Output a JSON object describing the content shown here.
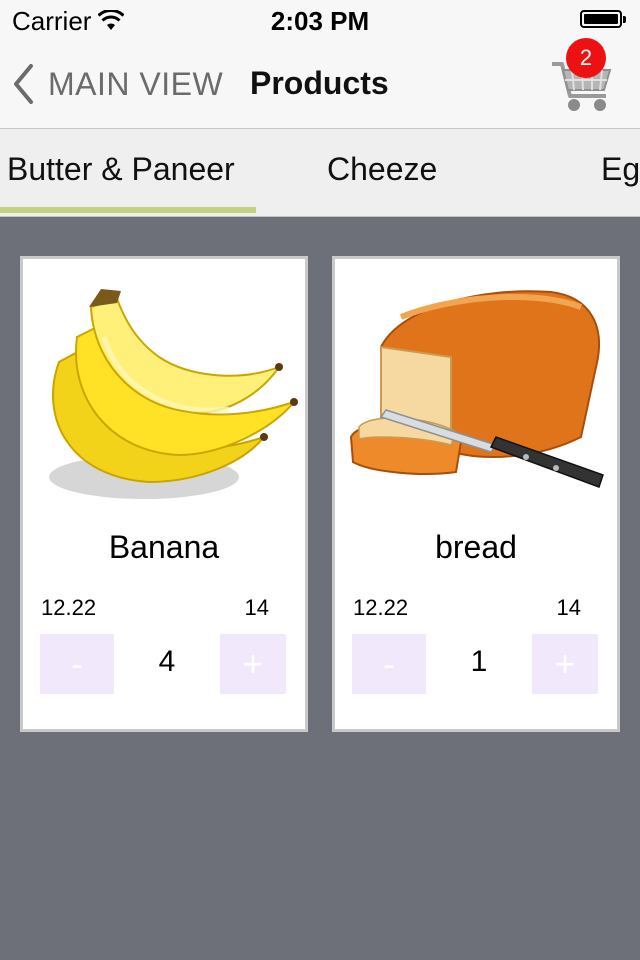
{
  "status_bar": {
    "carrier": "Carrier",
    "time": "2:03 PM"
  },
  "nav": {
    "back_label": "MAIN VIEW",
    "title": "Products",
    "cart_count": "2"
  },
  "tabs": [
    {
      "label": "Butter & Paneer",
      "selected": true
    },
    {
      "label": "Cheeze",
      "selected": false
    },
    {
      "label": "Eg",
      "selected": false
    }
  ],
  "products": [
    {
      "name": "Banana",
      "price": "12.22",
      "stock": "14",
      "quantity": "4",
      "image": "banana-image",
      "minus_label": "-",
      "plus_label": "+"
    },
    {
      "name": "bread",
      "price": "12.22",
      "stock": "14",
      "quantity": "1",
      "image": "bread-image",
      "minus_label": "-",
      "plus_label": "+"
    }
  ],
  "colors": {
    "background": "#6e7079",
    "tab_underline": "#c5d17c",
    "stepper_button": "#f2e8fb",
    "badge": "#ee1111"
  }
}
